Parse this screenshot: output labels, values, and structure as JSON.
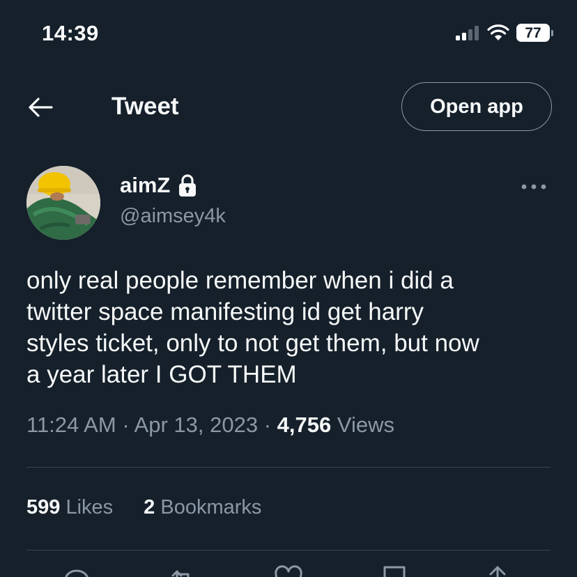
{
  "status_bar": {
    "time": "14:39",
    "battery": "77",
    "icons": [
      "cellular-signal-icon",
      "wifi-icon",
      "battery-icon"
    ]
  },
  "header": {
    "title": "Tweet",
    "open_app_label": "Open app",
    "back_icon": "arrow-left-icon"
  },
  "author": {
    "display_name": "aimZ",
    "handle": "@aimsey4k",
    "protected_icon": "lock-icon",
    "more_icon": "more-horizontal-icon"
  },
  "tweet": {
    "text": "only real people remember when i did a\ntwitter space manifesting id get harry\nstyles ticket, only to not get them, but now\na year later I GOT THEM",
    "time": "11:24 AM",
    "separator": "·",
    "date": "Apr 13, 2023",
    "views_count": "4,756",
    "views_label": "Views"
  },
  "stats": {
    "likes_count": "599",
    "likes_label": "Likes",
    "bookmarks_count": "2",
    "bookmarks_label": "Bookmarks"
  },
  "actions": [
    "reply-icon",
    "retweet-icon",
    "like-icon",
    "bookmark-icon",
    "share-icon"
  ],
  "colors": {
    "background": "#15202b",
    "text": "#f7f9f9",
    "secondary": "#8b98a5",
    "divider": "#38444d"
  }
}
